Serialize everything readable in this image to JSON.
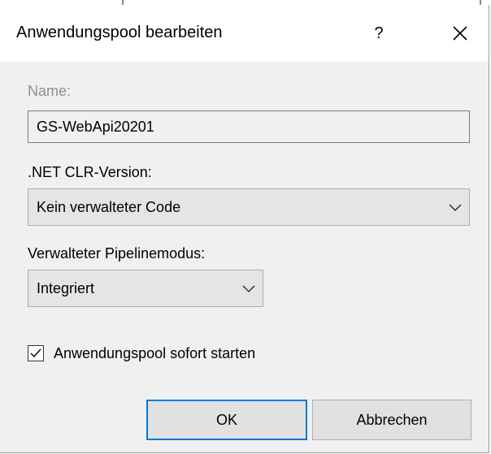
{
  "dialog": {
    "title": "Anwendungspool bearbeiten",
    "help_label": "?",
    "close_icon": "close-icon"
  },
  "form": {
    "name_label": "Name:",
    "name_value": "GS-WebApi20201",
    "clr_label": ".NET CLR-Version:",
    "clr_value": "Kein verwalteter Code",
    "pipeline_label": "Verwalteter Pipelinemodus:",
    "pipeline_value": "Integriert",
    "start_checkbox_label": "Anwendungspool sofort starten",
    "start_checked": true
  },
  "buttons": {
    "ok_label": "OK",
    "cancel_label": "Abbrechen"
  },
  "colors": {
    "dialog_background": "#f0f0f0",
    "titlebar_background": "#ffffff",
    "default_button_border": "#0078d7",
    "disabled_text": "#8f8f8f"
  }
}
